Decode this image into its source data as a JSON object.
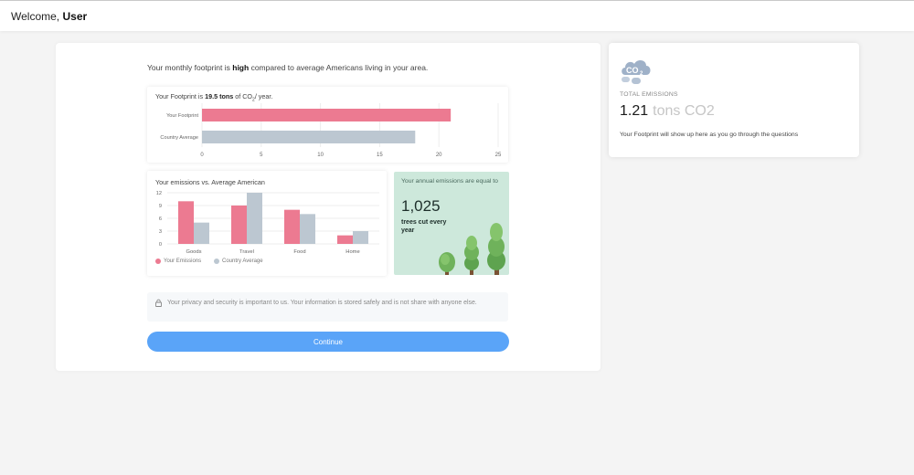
{
  "header": {
    "greeting": "Welcome,",
    "user": "User"
  },
  "headline": {
    "prefix": "Your monthly footprint is",
    "level": "high",
    "suffix": "compared to average Americans living in your area."
  },
  "footprint_card": {
    "prefix": "Your Footprint is",
    "value": "19.5 tons",
    "mid": "of CO",
    "sub": "2",
    "suffix": "/ year."
  },
  "emissions_card": {
    "title": "Your emissions vs. Average American"
  },
  "trees_card": {
    "caption": "Your annual emissions are equal to",
    "count": "1,025",
    "label": "trees cut every year"
  },
  "privacy": {
    "text": "Your privacy and security is important to us. Your information is stored safely and is not share with anyone else."
  },
  "continue_label": "Continue",
  "sidebar": {
    "total_label": "TOTAL EMISSIONS",
    "total_value": "1.21",
    "total_unit": "tons CO2",
    "note": "Your Footprint will show up here as you go through the questions"
  },
  "colors": {
    "yours": "#ec7a91",
    "average": "#bcc7d1",
    "accent": "#5aa4f8",
    "tree_bg": "#cde8db"
  },
  "chart_data": [
    {
      "type": "bar",
      "orientation": "horizontal",
      "categories": [
        "Your Footprint",
        "Country Average"
      ],
      "values": [
        21,
        18
      ],
      "xlim": [
        0,
        25
      ],
      "xticks": [
        0,
        5,
        10,
        15,
        20,
        25
      ],
      "grid": true
    },
    {
      "type": "bar",
      "title": "Your emissions vs. Average American",
      "categories": [
        "Goods",
        "Travel",
        "Food",
        "Home"
      ],
      "series": [
        {
          "name": "Your Emissions",
          "values": [
            10,
            9,
            8,
            2
          ]
        },
        {
          "name": "Country Average",
          "values": [
            5,
            12,
            7,
            3
          ]
        }
      ],
      "ylim": [
        0,
        12
      ],
      "yticks": [
        0,
        3,
        6,
        9,
        12
      ],
      "legend": "bottom-left",
      "grid": true
    }
  ]
}
